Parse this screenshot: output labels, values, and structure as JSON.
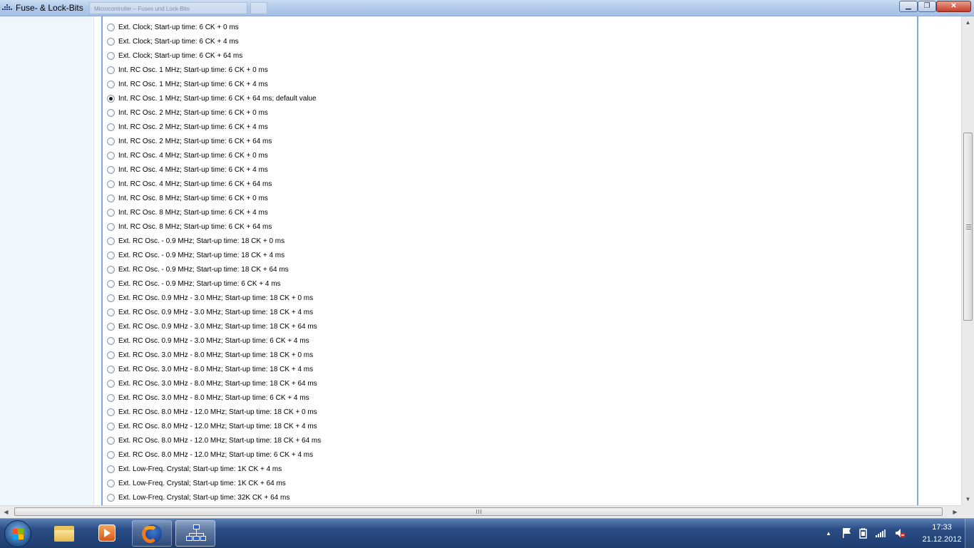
{
  "window": {
    "title": "Fuse- & Lock-Bits",
    "ghost_tab": "Microcontroller – Fuses und Lock-Bits",
    "min_glyph": "▁",
    "max_glyph": "❐",
    "close_glyph": "✕"
  },
  "options": [
    {
      "label": "Ext. Clock; Start-up time: 6 CK + 0 ms",
      "checked": false
    },
    {
      "label": "Ext. Clock; Start-up time: 6 CK + 4 ms",
      "checked": false
    },
    {
      "label": "Ext. Clock; Start-up time: 6 CK + 64 ms",
      "checked": false
    },
    {
      "label": "Int. RC Osc. 1 MHz; Start-up time: 6 CK + 0 ms",
      "checked": false
    },
    {
      "label": "Int. RC Osc. 1 MHz; Start-up time: 6 CK + 4 ms",
      "checked": false
    },
    {
      "label": "Int. RC Osc. 1 MHz; Start-up time: 6 CK + 64 ms; default value",
      "checked": true
    },
    {
      "label": "Int. RC Osc. 2 MHz; Start-up time: 6 CK + 0 ms",
      "checked": false
    },
    {
      "label": "Int. RC Osc. 2 MHz; Start-up time: 6 CK + 4 ms",
      "checked": false
    },
    {
      "label": "Int. RC Osc. 2 MHz; Start-up time: 6 CK + 64 ms",
      "checked": false
    },
    {
      "label": "Int. RC Osc. 4 MHz; Start-up time: 6 CK + 0 ms",
      "checked": false
    },
    {
      "label": "Int. RC Osc. 4 MHz; Start-up time: 6 CK + 4 ms",
      "checked": false
    },
    {
      "label": "Int. RC Osc. 4 MHz; Start-up time: 6 CK + 64 ms",
      "checked": false
    },
    {
      "label": "Int. RC Osc. 8 MHz; Start-up time: 6 CK + 0 ms",
      "checked": false
    },
    {
      "label": "Int. RC Osc. 8 MHz; Start-up time: 6 CK + 4 ms",
      "checked": false
    },
    {
      "label": "Int. RC Osc. 8 MHz; Start-up time: 6 CK + 64 ms",
      "checked": false
    },
    {
      "label": "Ext. RC Osc. - 0.9 MHz; Start-up time: 18 CK + 0 ms",
      "checked": false
    },
    {
      "label": "Ext. RC Osc. - 0.9 MHz; Start-up time: 18 CK + 4 ms",
      "checked": false
    },
    {
      "label": "Ext. RC Osc. - 0.9 MHz; Start-up time: 18 CK + 64 ms",
      "checked": false
    },
    {
      "label": "Ext. RC Osc. - 0.9 MHz; Start-up time: 6 CK + 4 ms",
      "checked": false
    },
    {
      "label": "Ext. RC Osc. 0.9 MHz - 3.0 MHz; Start-up time: 18 CK + 0 ms",
      "checked": false
    },
    {
      "label": "Ext. RC Osc. 0.9 MHz - 3.0 MHz; Start-up time: 18 CK + 4 ms",
      "checked": false
    },
    {
      "label": "Ext. RC Osc. 0.9 MHz - 3.0 MHz; Start-up time: 18 CK + 64 ms",
      "checked": false
    },
    {
      "label": "Ext. RC Osc. 0.9 MHz - 3.0 MHz; Start-up time: 6 CK + 4 ms",
      "checked": false
    },
    {
      "label": "Ext. RC Osc. 3.0 MHz - 8.0 MHz; Start-up time: 18 CK + 0 ms",
      "checked": false
    },
    {
      "label": "Ext. RC Osc. 3.0 MHz - 8.0 MHz; Start-up time: 18 CK + 4 ms",
      "checked": false
    },
    {
      "label": "Ext. RC Osc. 3.0 MHz - 8.0 MHz; Start-up time: 18 CK + 64 ms",
      "checked": false
    },
    {
      "label": "Ext. RC Osc. 3.0 MHz - 8.0 MHz; Start-up time: 6 CK + 4 ms",
      "checked": false
    },
    {
      "label": "Ext. RC Osc. 8.0 MHz - 12.0 MHz; Start-up time: 18 CK + 0 ms",
      "checked": false
    },
    {
      "label": "Ext. RC Osc. 8.0 MHz - 12.0 MHz; Start-up time: 18 CK + 4 ms",
      "checked": false
    },
    {
      "label": "Ext. RC Osc. 8.0 MHz - 12.0 MHz; Start-up time: 18 CK + 64 ms",
      "checked": false
    },
    {
      "label": "Ext. RC Osc. 8.0 MHz - 12.0 MHz; Start-up time: 6 CK + 4 ms",
      "checked": false
    },
    {
      "label": "Ext. Low-Freq. Crystal; Start-up time: 1K CK + 4 ms",
      "checked": false
    },
    {
      "label": "Ext. Low-Freq. Crystal; Start-up time: 1K CK + 64 ms",
      "checked": false
    },
    {
      "label": "Ext. Low-Freq. Crystal; Start-up time: 32K CK + 64 ms",
      "checked": false
    }
  ],
  "scrollbars": {
    "up_glyph": "▲",
    "down_glyph": "▼",
    "left_glyph": "◀",
    "right_glyph": "▶"
  },
  "taskbar": {
    "items": [
      {
        "name": "windows-explorer",
        "icon": "folder-icon",
        "state": "pinned"
      },
      {
        "name": "media-player",
        "icon": "media-player-icon",
        "state": "pinned"
      },
      {
        "name": "firefox",
        "icon": "firefox-icon",
        "state": "running"
      },
      {
        "name": "network-app",
        "icon": "network-icon",
        "state": "active"
      }
    ],
    "tray": {
      "show_hidden_glyph": "▲",
      "action_center_icon": "flag-icon",
      "device_icon": "device-icon",
      "signal_icon": "signal-icon",
      "volume_icon": "volume-muted-icon"
    },
    "clock": {
      "time": "17:33",
      "date": "21.12.2012"
    }
  },
  "colors": {
    "panel_border": "#7ea6e0",
    "left_panel": "#f0f6fe",
    "taskbar": "#1d3c6e"
  }
}
